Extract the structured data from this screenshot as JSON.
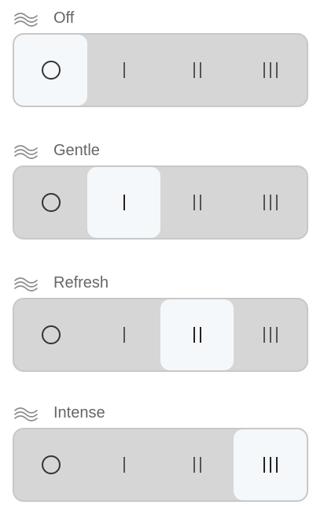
{
  "colors": {
    "track": "#d6d6d6",
    "track_border": "#c8c8c8",
    "selected": "#f5f8fb",
    "label_text": "#666666",
    "icon": "#8a8a8a"
  },
  "groups": [
    {
      "label": "Off",
      "icon": "wind-icon",
      "selected_index": 0,
      "options": [
        "off",
        "level-1",
        "level-2",
        "level-3"
      ]
    },
    {
      "label": "Gentle",
      "icon": "wind-icon",
      "selected_index": 1,
      "options": [
        "off",
        "level-1",
        "level-2",
        "level-3"
      ]
    },
    {
      "label": "Refresh",
      "icon": "wind-icon",
      "selected_index": 2,
      "options": [
        "off",
        "level-1",
        "level-2",
        "level-3"
      ]
    },
    {
      "label": "Intense",
      "icon": "wind-icon",
      "selected_index": 3,
      "options": [
        "off",
        "level-1",
        "level-2",
        "level-3"
      ]
    }
  ]
}
